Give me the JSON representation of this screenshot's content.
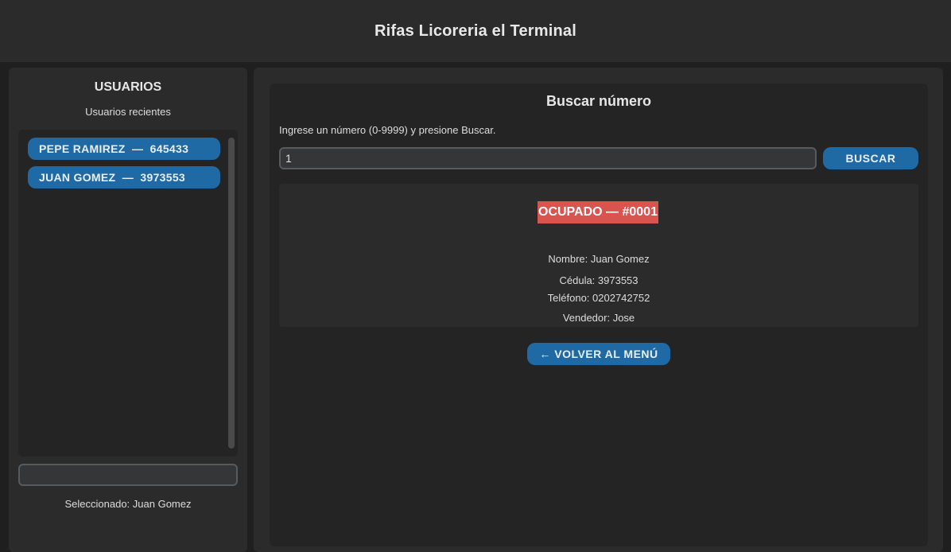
{
  "app": {
    "title": "Rifas Licoreria el Terminal"
  },
  "sidebar": {
    "title": "USUARIOS",
    "subtitle": "Usuarios recientes",
    "users": [
      {
        "label": "PEPE RAMIREZ  —  645433"
      },
      {
        "label": "JUAN GOMEZ  —  3973553"
      }
    ],
    "entry_value": "",
    "selected_text": "Seleccionado: Juan Gomez"
  },
  "search": {
    "title": "Buscar número",
    "instructions": "Ingrese un número (0-9999) y presione Buscar.",
    "input_value": "1",
    "button_label": "BUSCAR"
  },
  "result": {
    "status": "OCUPADO — #0001",
    "status_color": "#d9534f",
    "name": "Nombre: Juan Gomez",
    "id": "Cédula: 3973553",
    "phone": "Teléfono: 0202742752",
    "seller": "Vendedor: Jose"
  },
  "back_button": {
    "label": "← VOLVER AL MENÚ"
  },
  "colors": {
    "accent": "#1f6aa5",
    "background": "#1f1f1f",
    "panel": "#2b2b2b",
    "occupied": "#d9534f"
  }
}
